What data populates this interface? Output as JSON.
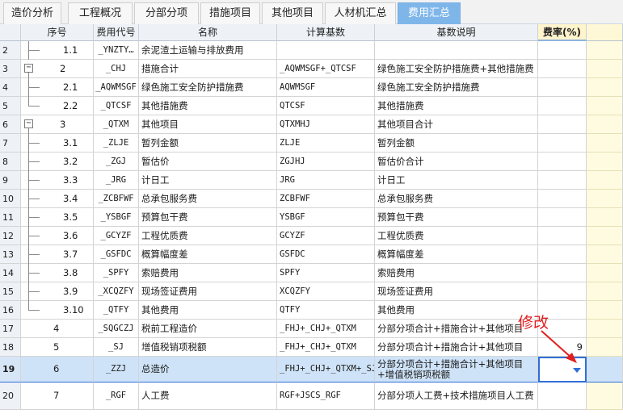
{
  "tabs": [
    {
      "label": "造价分析",
      "active": false
    },
    {
      "label": "工程概况",
      "active": false
    },
    {
      "label": "分部分项",
      "active": false
    },
    {
      "label": "措施项目",
      "active": false
    },
    {
      "label": "其他项目",
      "active": false
    },
    {
      "label": "人材机汇总",
      "active": false
    },
    {
      "label": "费用汇总",
      "active": true
    }
  ],
  "columns": {
    "seq": "序号",
    "code": "费用代号",
    "name": "名称",
    "base": "计算基数",
    "desc": "基数说明",
    "rate": "费率(%)"
  },
  "rows": [
    {
      "no": "2",
      "seq": "1.1",
      "level": 2,
      "code": "_YNZTY…",
      "name": "余泥渣土运输与排放费用",
      "base": "",
      "desc": "",
      "rate": ""
    },
    {
      "no": "3",
      "seq": "2",
      "level": 1,
      "expander": "−",
      "code": "_CHJ",
      "name": "措施合计",
      "base": "_AQWMSGF+_QTCSF",
      "desc": "绿色施工安全防护措施费+其他措施费",
      "rate": ""
    },
    {
      "no": "4",
      "seq": "2.1",
      "level": 2,
      "code": "_AQWMSGF",
      "name": "绿色施工安全防护措施费",
      "base": "AQWMSGF",
      "desc": "绿色施工安全防护措施费",
      "rate": ""
    },
    {
      "no": "5",
      "seq": "2.2",
      "level": 2,
      "last": true,
      "code": "_QTCSF",
      "name": "其他措施费",
      "base": "QTCSF",
      "desc": "其他措施费",
      "rate": ""
    },
    {
      "no": "6",
      "seq": "3",
      "level": 1,
      "expander": "−",
      "code": "_QTXM",
      "name": "其他项目",
      "base": "QTXMHJ",
      "desc": "其他项目合计",
      "rate": ""
    },
    {
      "no": "7",
      "seq": "3.1",
      "level": 2,
      "code": "_ZLJE",
      "name": "暂列金额",
      "base": "ZLJE",
      "desc": "暂列金额",
      "rate": ""
    },
    {
      "no": "8",
      "seq": "3.2",
      "level": 2,
      "code": "_ZGJ",
      "name": "暂估价",
      "base": "ZGJHJ",
      "desc": "暂估价合计",
      "rate": ""
    },
    {
      "no": "9",
      "seq": "3.3",
      "level": 2,
      "code": "_JRG",
      "name": "计日工",
      "base": "JRG",
      "desc": "计日工",
      "rate": ""
    },
    {
      "no": "10",
      "seq": "3.4",
      "level": 2,
      "code": "_ZCBFWF",
      "name": "总承包服务费",
      "base": "ZCBFWF",
      "desc": "总承包服务费",
      "rate": ""
    },
    {
      "no": "11",
      "seq": "3.5",
      "level": 2,
      "code": "_YSBGF",
      "name": "预算包干费",
      "base": "YSBGF",
      "desc": "预算包干费",
      "rate": ""
    },
    {
      "no": "12",
      "seq": "3.6",
      "level": 2,
      "code": "_GCYZF",
      "name": "工程优质费",
      "base": "GCYZF",
      "desc": "工程优质费",
      "rate": ""
    },
    {
      "no": "13",
      "seq": "3.7",
      "level": 2,
      "code": "_GSFDC",
      "name": "概算幅度差",
      "base": "GSFDC",
      "desc": "概算幅度差",
      "rate": ""
    },
    {
      "no": "14",
      "seq": "3.8",
      "level": 2,
      "code": "_SPFY",
      "name": "索赔费用",
      "base": "SPFY",
      "desc": "索赔费用",
      "rate": ""
    },
    {
      "no": "15",
      "seq": "3.9",
      "level": 2,
      "code": "_XCQZFY",
      "name": "现场签证费用",
      "base": "XCQZFY",
      "desc": "现场签证费用",
      "rate": ""
    },
    {
      "no": "16",
      "seq": "3.10",
      "level": 2,
      "last": true,
      "code": "_QTFY",
      "name": "其他费用",
      "base": "QTFY",
      "desc": "其他费用",
      "rate": ""
    },
    {
      "no": "17",
      "seq": "4",
      "level": 0,
      "code": "_SQGCZJ",
      "name": "税前工程造价",
      "base": "_FHJ+_CHJ+_QTXM",
      "desc": "分部分项合计+措施合计+其他项目",
      "rate": ""
    },
    {
      "no": "18",
      "seq": "5",
      "level": 0,
      "code": "_SJ",
      "name": "增值税销项税额",
      "base": "_FHJ+_CHJ+_QTXM",
      "desc": "分部分项合计+措施合计+其他项目",
      "rate": "9"
    },
    {
      "no": "19",
      "seq": "6",
      "level": 0,
      "selected": true,
      "code": "_ZZJ",
      "name": "总造价",
      "base": "_FHJ+_CHJ+_QTXM+_SJ",
      "desc": "分部分项合计+措施合计+其他项目+增值税销项税额",
      "rate": ""
    },
    {
      "no": "20",
      "seq": "7",
      "level": 0,
      "code": "_RGF",
      "name": "人工费",
      "base": "RGF+JSCS_RGF",
      "desc": "分部分项人工费+技术措施项目人工费",
      "rate": ""
    }
  ],
  "annotation": {
    "text": "修改",
    "color": "#e02020"
  }
}
